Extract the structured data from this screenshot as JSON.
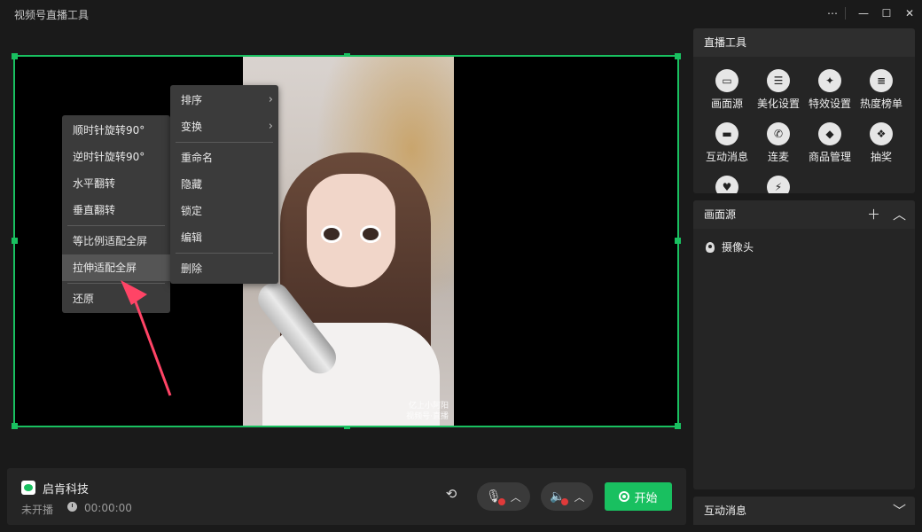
{
  "window": {
    "title": "视频号直播工具",
    "controls": [
      "more-icon",
      "minimize-icon",
      "maximize-icon",
      "close-icon"
    ]
  },
  "context_menu_left": {
    "items": [
      "顺时针旋转90°",
      "逆时针旋转90°",
      "水平翻转",
      "垂直翻转",
      "等比例适配全屏",
      "拉伸适配全屏",
      "还原"
    ],
    "highlighted": "拉伸适配全屏"
  },
  "context_menu_right": {
    "items": [
      "排序",
      "变换",
      "重命名",
      "隐藏",
      "锁定",
      "编辑",
      "删除"
    ]
  },
  "video": {
    "watermark_line1": "亿上小阿阳",
    "watermark_line2": "视频号·直播"
  },
  "bottom_bar": {
    "room_name": "启肯科技",
    "status": "未开播",
    "timer": "00:00:00",
    "start_label": "开始"
  },
  "tools_panel": {
    "title": "直播工具",
    "tools": [
      {
        "label": "画面源",
        "icon": "screen-icon"
      },
      {
        "label": "美化设置",
        "icon": "sliders-icon"
      },
      {
        "label": "特效设置",
        "icon": "sparkle-icon"
      },
      {
        "label": "热度榜单",
        "icon": "list-icon"
      },
      {
        "label": "互动消息",
        "icon": "message-icon"
      },
      {
        "label": "连麦",
        "icon": "phone-icon"
      },
      {
        "label": "商品管理",
        "icon": "shopping-bag-icon"
      },
      {
        "label": "抽奖",
        "icon": "gift-icon"
      },
      {
        "label": "",
        "icon": "heart-icon"
      },
      {
        "label": "",
        "icon": "wand-icon"
      }
    ]
  },
  "sources_panel": {
    "title": "画面源",
    "items": [
      "摄像头"
    ]
  },
  "interaction_panel": {
    "title": "互动消息"
  },
  "colors": {
    "accent": "#19c060",
    "bg": "#1a1a1a",
    "panel": "#252525",
    "menu": "#3b3b3b"
  }
}
